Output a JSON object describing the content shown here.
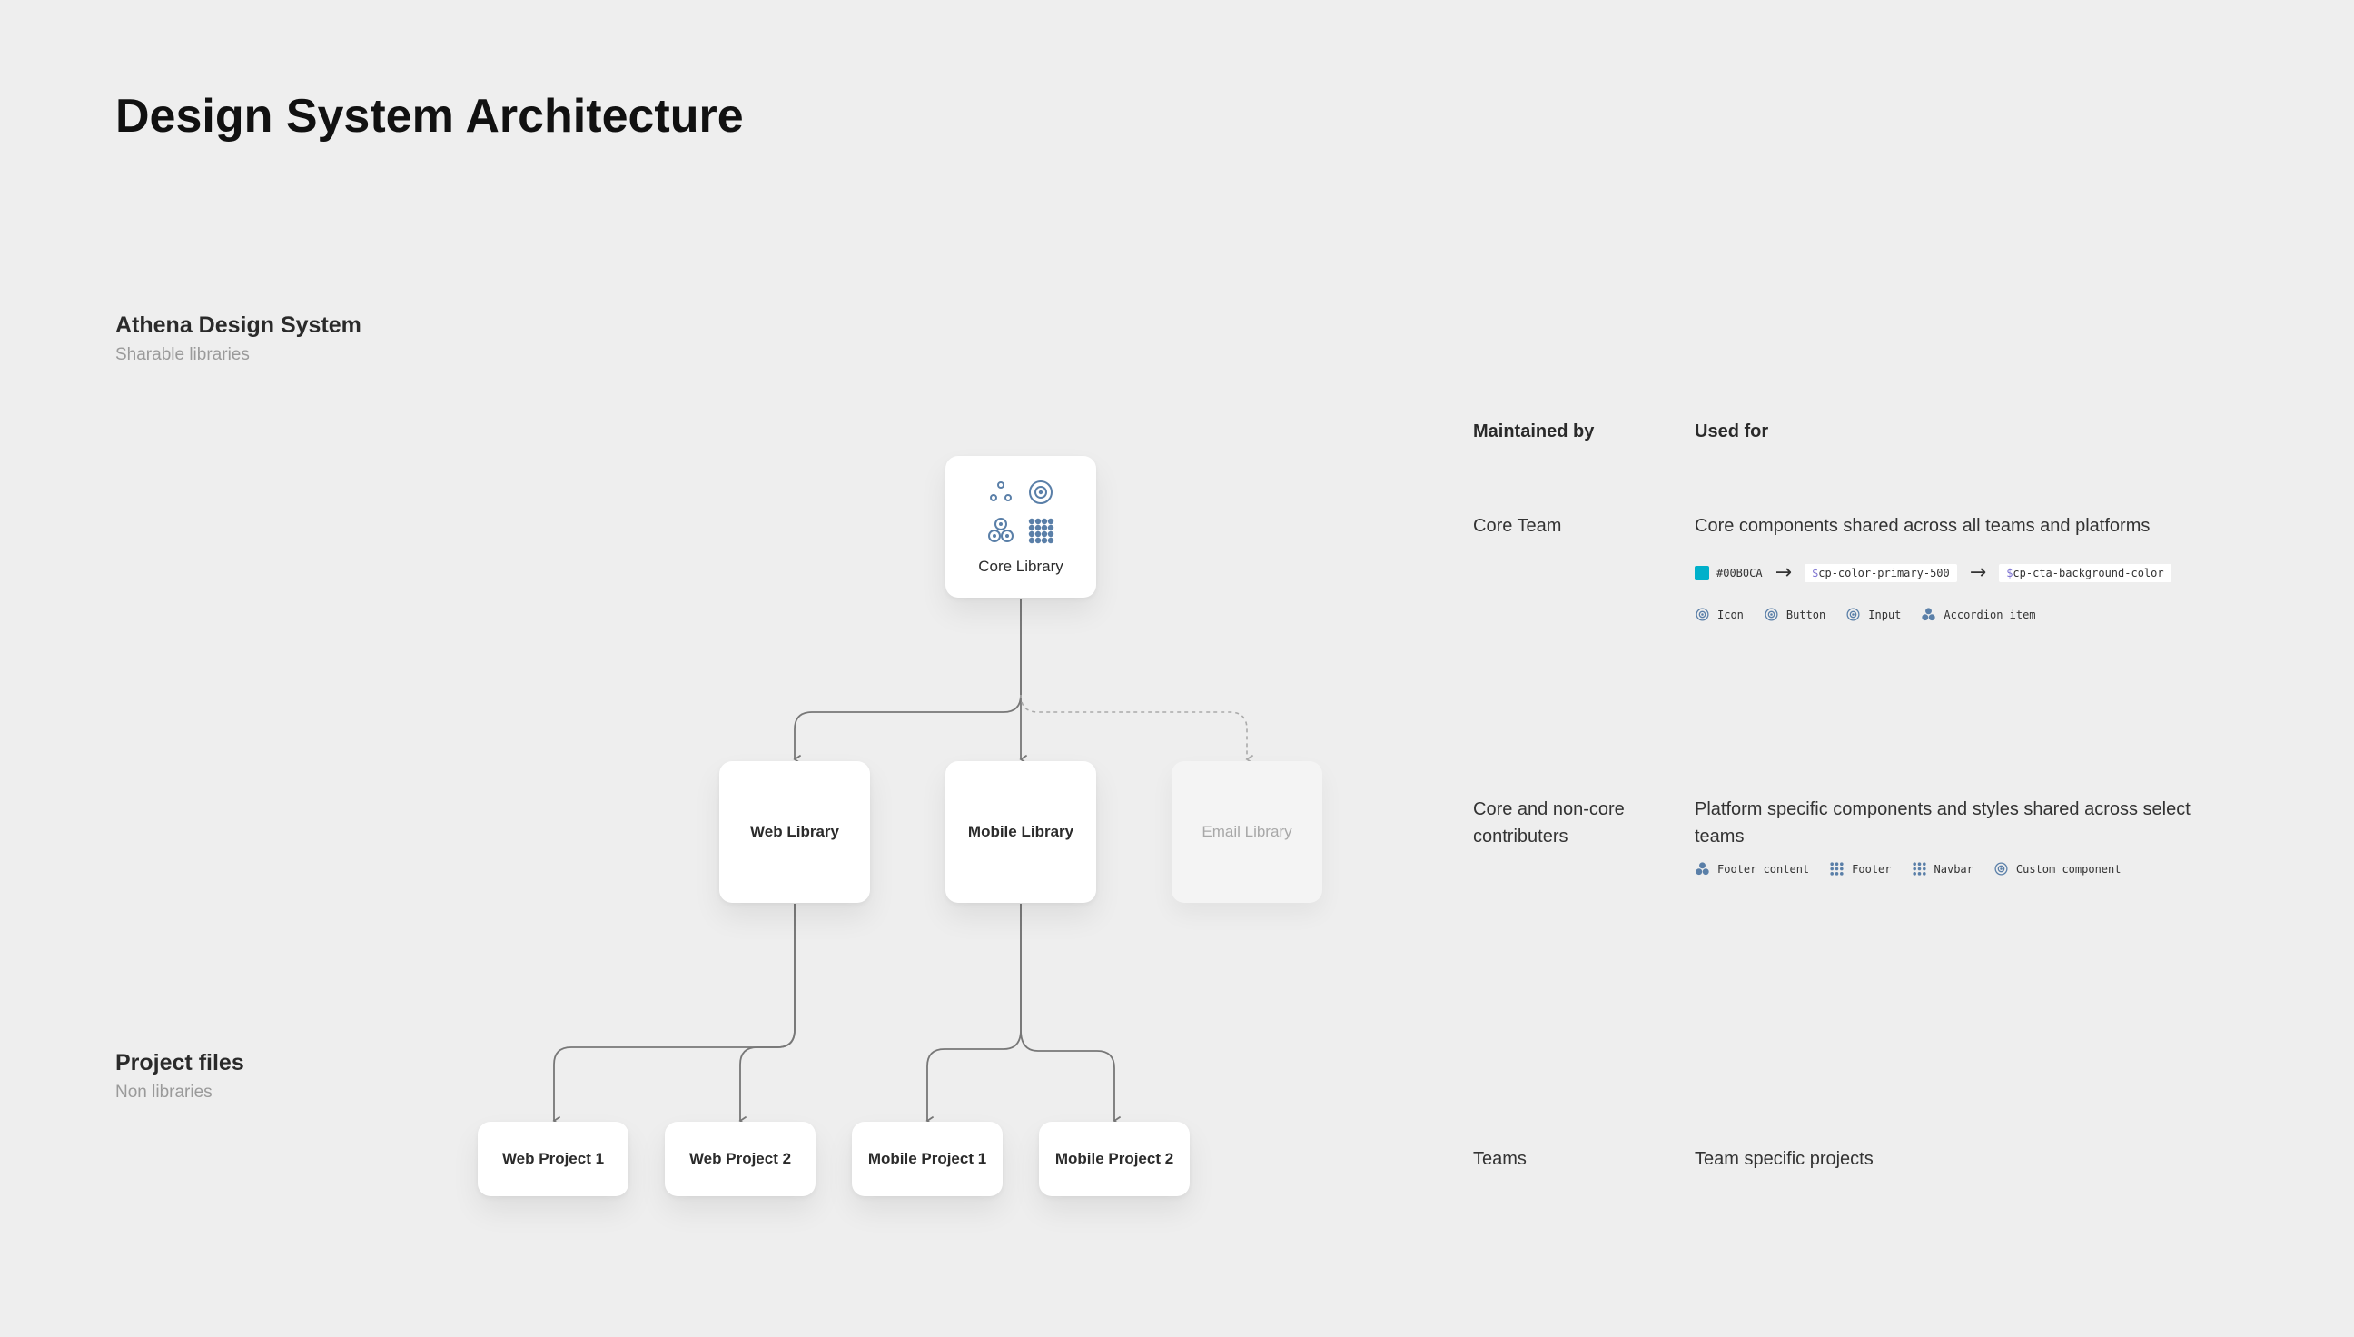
{
  "page": {
    "title": "Design System Architecture"
  },
  "sections": {
    "libraries": {
      "title": "Athena Design System",
      "subtitle": "Sharable libraries"
    },
    "projects": {
      "title": "Project files",
      "subtitle": "Non libraries"
    }
  },
  "nodes": {
    "core": "Core Library",
    "web": "Web Library",
    "mobile": "Mobile Library",
    "email": "Email Library",
    "web_project_1": "Web Project 1",
    "web_project_2": "Web Project 2",
    "mobile_project_1": "Mobile Project 1",
    "mobile_project_2": "Mobile Project 2"
  },
  "table": {
    "headers": {
      "maintained_by": "Maintained by",
      "used_for": "Used for"
    },
    "rows": [
      {
        "maintained_by": "Core Team",
        "used_for": "Core components shared across all teams and platforms",
        "tokens": {
          "color_hex": "#00B0CA",
          "swatch_color": "#00B0CA",
          "primitive_prefix": "$",
          "primitive": "cp-color-primary-500",
          "semantic_prefix": "$",
          "semantic": "cp-cta-background-color"
        },
        "components": [
          {
            "label": "Icon",
            "icon": "target-icon"
          },
          {
            "label": "Button",
            "icon": "target-icon"
          },
          {
            "label": "Input",
            "icon": "target-icon"
          },
          {
            "label": "Accordion item",
            "icon": "cluster-icon"
          }
        ]
      },
      {
        "maintained_by": "Core and non-core contributers",
        "used_for": "Platform specific components and styles shared across select teams",
        "components": [
          {
            "label": "Footer content",
            "icon": "cluster-icon"
          },
          {
            "label": "Footer",
            "icon": "grid-icon"
          },
          {
            "label": "Navbar",
            "icon": "grid-icon"
          },
          {
            "label": "Custom component",
            "icon": "target-icon"
          }
        ]
      },
      {
        "maintained_by": "Teams",
        "used_for": "Team specific projects"
      }
    ]
  },
  "colors": {
    "icon_blue": "#5a7fa8",
    "connector": "#777777",
    "connector_dashed": "#aaaaaa"
  }
}
